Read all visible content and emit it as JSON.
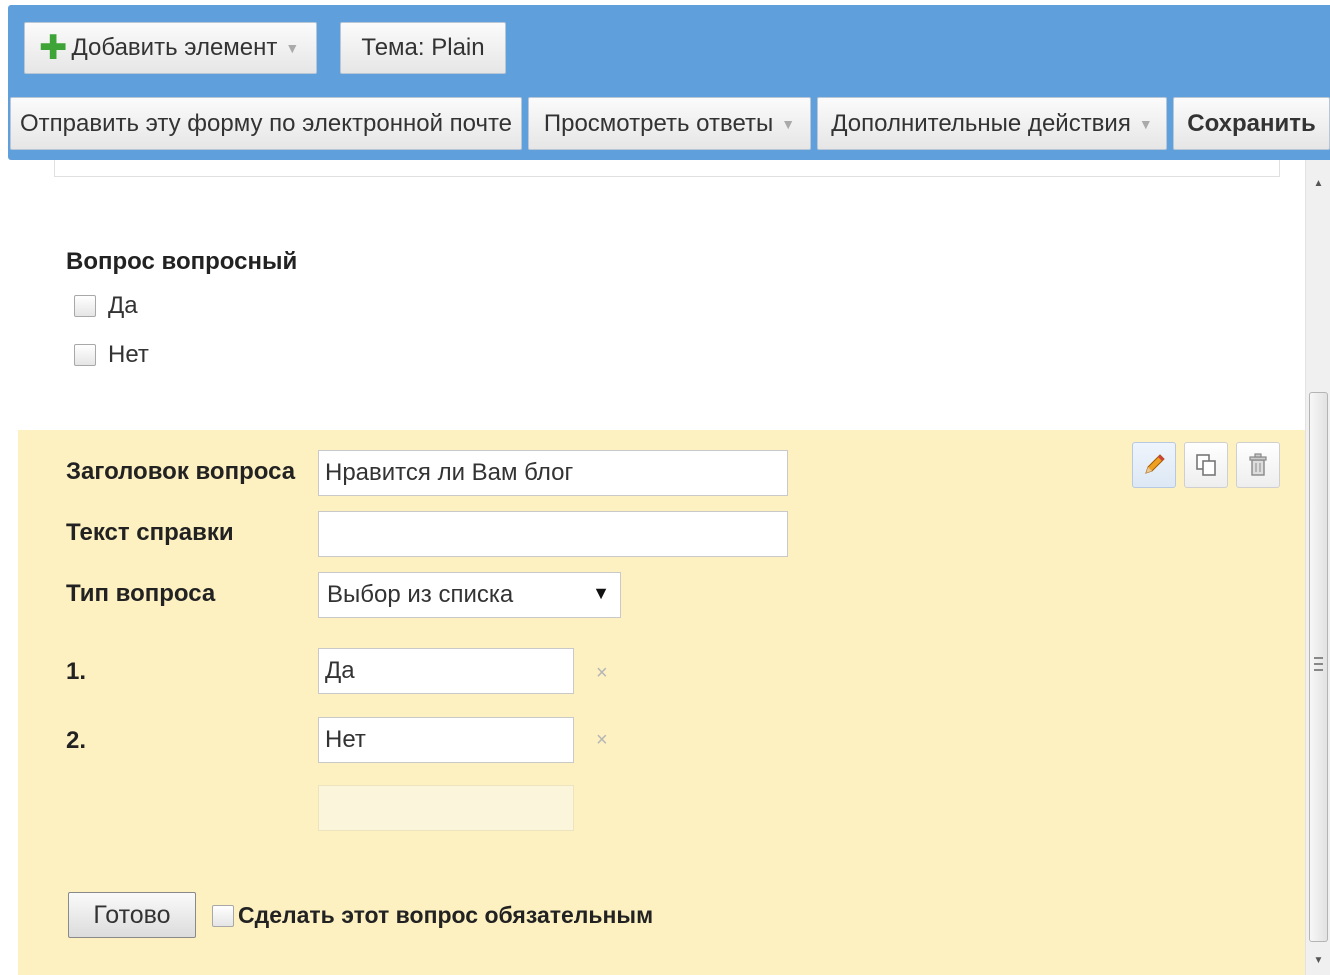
{
  "toolbar": {
    "add_element_label": "Добавить элемент",
    "theme_label": "Тема:",
    "theme_value": "Plain",
    "email_form_label": "Отправить эту форму по электронной почте",
    "view_responses_label": "Просмотреть ответы",
    "more_actions_label": "Дополнительные действия",
    "save_label": "Сохранить"
  },
  "preview_question": {
    "title": "Вопрос вопросный",
    "options": [
      "Да",
      "Нет"
    ]
  },
  "editor": {
    "question_title_label": "Заголовок вопроса",
    "question_title_value": "Нравится ли Вам блог",
    "help_text_label": "Текст справки",
    "help_text_value": "",
    "question_type_label": "Тип вопроса",
    "question_type_value": "Выбор из списка",
    "options": [
      {
        "number": "1.",
        "value": "Да"
      },
      {
        "number": "2.",
        "value": "Нет"
      }
    ],
    "remove_symbol": "×",
    "done_label": "Готово",
    "required_label": "Сделать этот вопрос обязательным",
    "tool_icons": [
      "pencil-icon",
      "copy-icon",
      "trash-icon"
    ]
  },
  "colors": {
    "toolbar_bg": "#5f9fdc",
    "edit_panel_bg": "#fdf1c2",
    "add_plus": "#3fa438"
  }
}
